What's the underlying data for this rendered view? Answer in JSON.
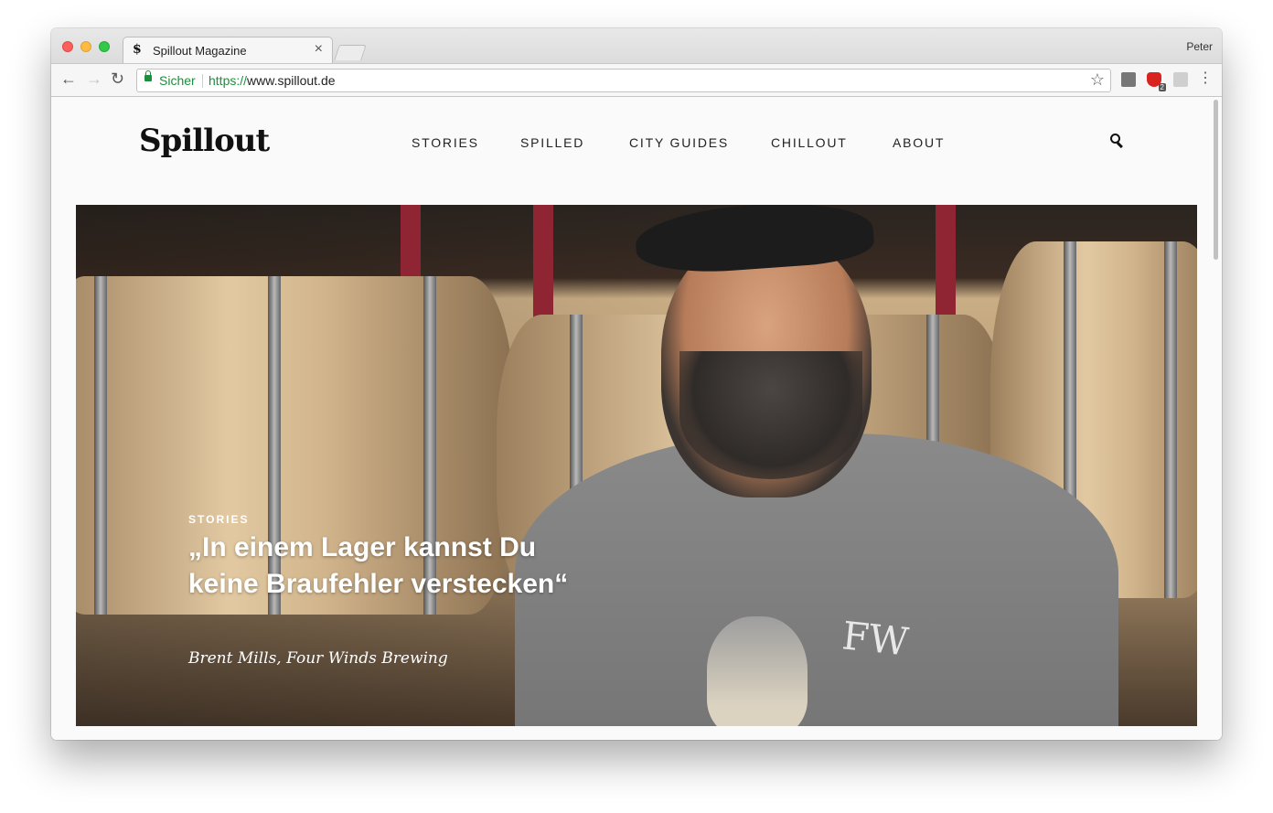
{
  "browser": {
    "tab_favicon": "$",
    "tab_title": "Spillout Magazine",
    "tab_close": "×",
    "profile_name": "Peter",
    "security_label": "Sicher",
    "url_protocol": "https://",
    "url_host": "www.spillout.de",
    "ext_badge": "2"
  },
  "site": {
    "logo": "Spillout",
    "nav": [
      "STORIES",
      "SPILLED",
      "CITY GUIDES",
      "CHILLOUT",
      "ABOUT"
    ]
  },
  "hero": {
    "kicker": "STORIES",
    "headline": "„In einem Lager kannst Du keine Braufehler verstecken“",
    "byline": "Brent Mills, Four Winds Brewing",
    "shirt_print": "FW"
  },
  "colors": {
    "secure_green": "#1e8e3e",
    "text_dark": "#222222",
    "hero_text": "#ffffff"
  },
  "icons": [
    "back-arrow-icon",
    "forward-arrow-icon",
    "reload-icon",
    "lock-icon",
    "star-icon",
    "kebab-menu-icon",
    "search-icon"
  ]
}
